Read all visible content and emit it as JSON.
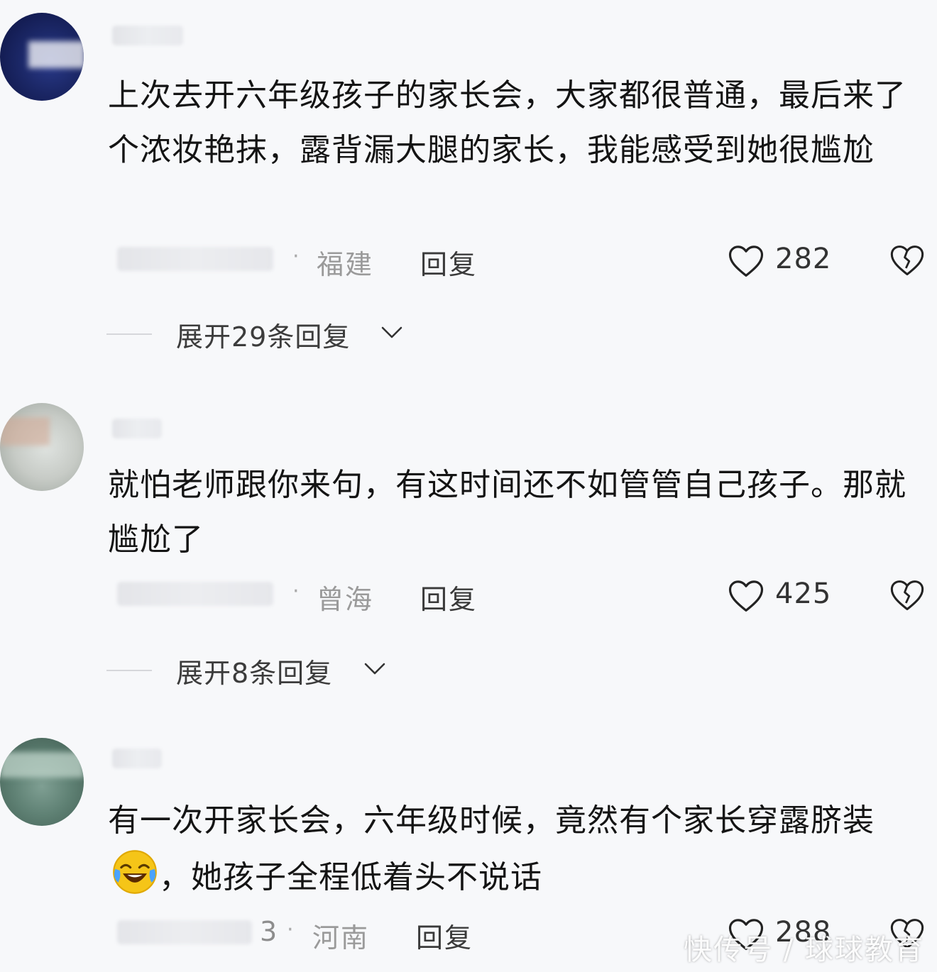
{
  "comments": [
    {
      "text": "上次去开六年级孩子的家长会，大家都很普通，最后来了个浓妆艳抹，露背漏大腿的家长，我能感受到她很尴尬",
      "location": "福建",
      "reply_label": "回复",
      "likes": "282",
      "expand_label": "展开29条回复"
    },
    {
      "text": "就怕老师跟你来句，有这时间还不如管管自己孩子。那就尴尬了",
      "location": "曾海",
      "reply_label": "回复",
      "likes": "425",
      "expand_label": "展开8条回复"
    },
    {
      "text_before_emoji": "有一次开家长会，六年级时候，竟然有个家长穿露脐装",
      "emoji": "laughing-crying-emoji",
      "text_after_emoji": "，她孩子全程低着头不说话",
      "time_suffix": "3",
      "location": "河南",
      "reply_label": "回复",
      "likes": "288"
    }
  ],
  "watermark": "快传号 / 球球教育",
  "icons": {
    "like": "heart-outline-icon",
    "dislike": "broken-heart-icon",
    "expand": "chevron-down-icon"
  }
}
